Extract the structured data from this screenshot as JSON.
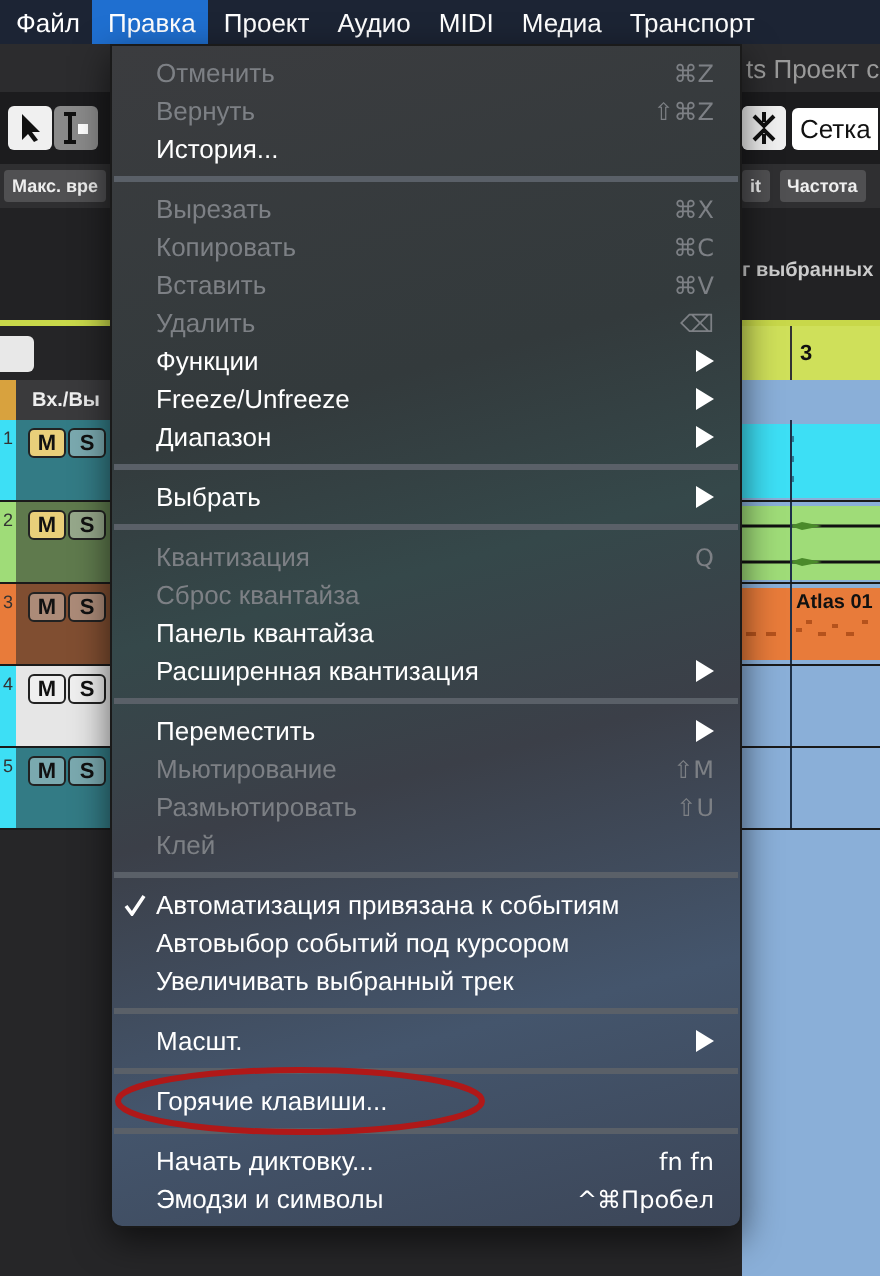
{
  "menu_bar": [
    {
      "label": "Файл",
      "selected": false
    },
    {
      "label": "Правка",
      "selected": true
    },
    {
      "label": "Проект",
      "selected": false
    },
    {
      "label": "Аудио",
      "selected": false
    },
    {
      "label": "MIDI",
      "selected": false
    },
    {
      "label": "Медиа",
      "selected": false
    },
    {
      "label": "Транспорт",
      "selected": false
    }
  ],
  "project_title": "ts Проект с",
  "toolbar": {
    "snap_mode": "Сетка"
  },
  "info_bar": {
    "left_button": "Макс. вре",
    "right_buttons": [
      "it",
      "Частота"
    ]
  },
  "info_text": "г выбранных",
  "ruler": {
    "bar_number": "3"
  },
  "track_header": {
    "column_label": "Вх./Вы"
  },
  "tracks": [
    {
      "number": "1",
      "color": "#3ddff5",
      "selected": false,
      "muted": true,
      "mute_label": "M",
      "solo_label": "S",
      "clip": {
        "kind": "markers"
      }
    },
    {
      "number": "2",
      "color": "#9fdc78",
      "selected": false,
      "muted": true,
      "mute_label": "M",
      "solo_label": "S",
      "clip": {
        "kind": "automation"
      }
    },
    {
      "number": "3",
      "color": "#e87b3a",
      "selected": false,
      "muted": false,
      "mute_label": "M",
      "solo_label": "S",
      "clip": {
        "kind": "midi",
        "title": "Atlas 01"
      }
    },
    {
      "number": "4",
      "color": "#3ddff5",
      "selected": true,
      "muted": false,
      "mute_label": "M",
      "solo_label": "S"
    },
    {
      "number": "5",
      "color": "#3ddff5",
      "selected": false,
      "muted": false,
      "mute_label": "M",
      "solo_label": "S"
    }
  ],
  "edit_menu": [
    {
      "kind": "item",
      "label": "Отменить",
      "shortcut": "⌘Z",
      "disabled": true
    },
    {
      "kind": "item",
      "label": "Вернуть",
      "shortcut": "⇧⌘Z",
      "disabled": true
    },
    {
      "kind": "item",
      "label": "История...",
      "disabled": false
    },
    {
      "kind": "separator"
    },
    {
      "kind": "item",
      "label": "Вырезать",
      "shortcut": "⌘X",
      "disabled": true
    },
    {
      "kind": "item",
      "label": "Копировать",
      "shortcut": "⌘C",
      "disabled": true
    },
    {
      "kind": "item",
      "label": "Вставить",
      "shortcut": "⌘V",
      "disabled": true
    },
    {
      "kind": "item",
      "label": "Удалить",
      "shortcut": "⌫",
      "disabled": true
    },
    {
      "kind": "item",
      "label": "Функции",
      "disabled": false,
      "submenu": true
    },
    {
      "kind": "item",
      "label": "Freeze/Unfreeze",
      "disabled": false,
      "submenu": true
    },
    {
      "kind": "item",
      "label": "Диапазон",
      "disabled": false,
      "submenu": true
    },
    {
      "kind": "separator"
    },
    {
      "kind": "item",
      "label": "Выбрать",
      "disabled": false,
      "submenu": true
    },
    {
      "kind": "separator"
    },
    {
      "kind": "item",
      "label": "Квантизация",
      "shortcut": "Q",
      "disabled": true
    },
    {
      "kind": "item",
      "label": "Сброс квантайза",
      "disabled": true
    },
    {
      "kind": "item",
      "label": "Панель квантайза",
      "disabled": false
    },
    {
      "kind": "item",
      "label": "Расширенная квантизация",
      "disabled": false,
      "submenu": true
    },
    {
      "kind": "separator"
    },
    {
      "kind": "item",
      "label": "Переместить",
      "disabled": false,
      "submenu": true
    },
    {
      "kind": "item",
      "label": "Мьютирование",
      "shortcut": "⇧M",
      "disabled": true
    },
    {
      "kind": "item",
      "label": "Размьютировать",
      "shortcut": "⇧U",
      "disabled": true
    },
    {
      "kind": "item",
      "label": "Клей",
      "disabled": true
    },
    {
      "kind": "separator"
    },
    {
      "kind": "item",
      "label": "Автоматизация привязана к событиям",
      "disabled": false,
      "checked": true
    },
    {
      "kind": "item",
      "label": "Автовыбор событий под курсором",
      "disabled": false,
      "checked": false
    },
    {
      "kind": "item",
      "label": "Увеличивать выбранный трек",
      "disabled": false,
      "checked": false
    },
    {
      "kind": "separator"
    },
    {
      "kind": "item",
      "label": "Масшт.",
      "disabled": false,
      "submenu": true
    },
    {
      "kind": "separator"
    },
    {
      "kind": "item",
      "label": "Горячие клавиши...",
      "disabled": false,
      "circled": true
    },
    {
      "kind": "separator"
    },
    {
      "kind": "item",
      "label": "Начать диктовку...",
      "shortcut": "fn fn",
      "disabled": false
    },
    {
      "kind": "item",
      "label": "Эмодзи и символы",
      "shortcut": "^⌘Пробел",
      "disabled": false
    }
  ]
}
